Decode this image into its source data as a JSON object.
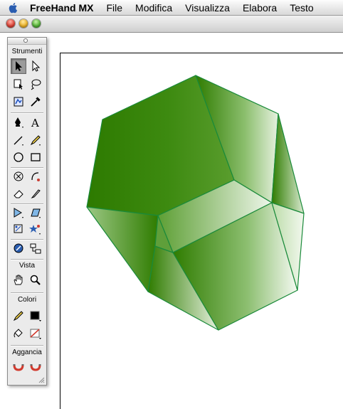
{
  "menubar": {
    "app_name": "FreeHand MX",
    "items": [
      "File",
      "Modifica",
      "Visualizza",
      "Elabora",
      "Testo"
    ]
  },
  "toolbox": {
    "sections": {
      "tools": "Strumenti",
      "view": "Vista",
      "colors": "Colori",
      "snap": "Aggancia"
    },
    "stroke_color": "#000000",
    "fill_color": "none",
    "active_tool": "pointer"
  },
  "artwork": {
    "fill_dark": "#2f7d00",
    "fill_light": "#f2f8ee",
    "stroke": "#1a8a3a"
  }
}
